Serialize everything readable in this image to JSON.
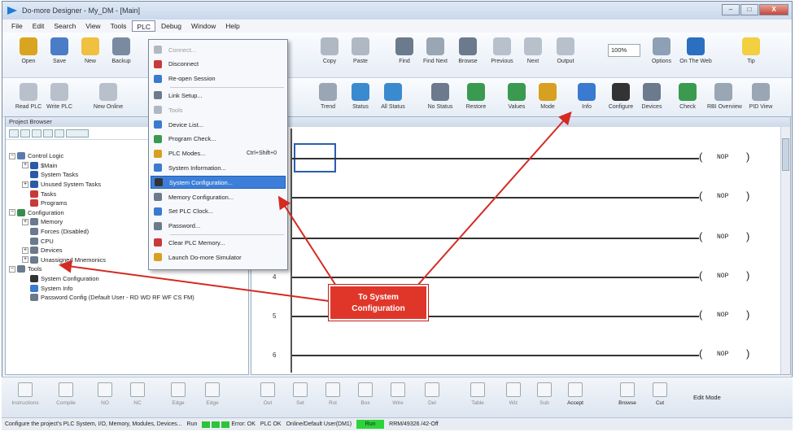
{
  "window": {
    "title": "Do-more Designer - My_DM - [Main]",
    "controls": [
      "–",
      "□",
      "X"
    ]
  },
  "menubar": [
    "File",
    "Edit",
    "Search",
    "View",
    "Tools",
    "PLC",
    "Debug",
    "Window",
    "Help"
  ],
  "toolbar1": [
    {
      "label": "Open",
      "icon": "open-icon",
      "color": "#d9a520"
    },
    {
      "label": "Save",
      "icon": "save-icon",
      "color": "#4a7cc8"
    },
    {
      "label": "New",
      "icon": "new-icon",
      "color": "#f0c040"
    },
    {
      "label": "Backup",
      "icon": "backup-icon",
      "color": "#7a8aa0"
    },
    {
      "label": "Copy",
      "icon": "copy-icon",
      "color": "#b0b8c4"
    },
    {
      "label": "Paste",
      "icon": "paste-icon",
      "color": "#b0b8c4"
    },
    {
      "label": "Find",
      "icon": "find-icon",
      "color": "#6b7a8c"
    },
    {
      "label": "Find Next",
      "icon": "find-next-icon",
      "color": "#9aa6b4"
    },
    {
      "label": "Browse",
      "icon": "browse-icon",
      "color": "#6b7a8c"
    },
    {
      "label": "Previous",
      "icon": "previous-icon",
      "color": "#b8c0cc"
    },
    {
      "label": "Next",
      "icon": "next-icon",
      "color": "#b8c0cc"
    },
    {
      "label": "Output",
      "icon": "output-icon",
      "color": "#b8c0cc"
    },
    {
      "label": "Options",
      "icon": "options-icon",
      "color": "#8ea0b6"
    },
    {
      "label": "On The Web",
      "icon": "web-icon",
      "color": "#2a6fc0"
    },
    {
      "label": "Tip",
      "icon": "tip-icon",
      "color": "#f2d040"
    }
  ],
  "zoom": "100%",
  "toolbar2": [
    {
      "label": "Read PLC",
      "icon": "read-plc-icon",
      "color": "#b8c0cc"
    },
    {
      "label": "Write PLC",
      "icon": "write-plc-icon",
      "color": "#b8c0cc"
    },
    {
      "label": "Trend",
      "icon": "trend-icon",
      "color": "#9aa6b4"
    },
    {
      "label": "Status",
      "icon": "status-icon",
      "color": "#3a8ad0"
    },
    {
      "label": "All Status",
      "icon": "all-status-icon",
      "color": "#3a8ad0"
    },
    {
      "label": "No Status",
      "icon": "no-status-icon",
      "color": "#6b7a8c"
    },
    {
      "label": "Restore",
      "icon": "restore-icon",
      "color": "#3a9a50"
    },
    {
      "label": "Values",
      "icon": "values-icon",
      "color": "#3a9a50"
    },
    {
      "label": "Mode",
      "icon": "mode-icon",
      "color": "#d8a020"
    },
    {
      "label": "Info",
      "icon": "info-icon",
      "color": "#3a7ad0"
    },
    {
      "label": "Configure",
      "icon": "configure-icon",
      "color": "#333333"
    },
    {
      "label": "Devices",
      "icon": "devices-icon",
      "color": "#6b7a8c"
    },
    {
      "label": "Check",
      "icon": "check-icon",
      "color": "#3a9a50"
    },
    {
      "label": "RBI Overview",
      "icon": "rbi-overview-icon",
      "color": "#9aa6b4"
    },
    {
      "label": "PID View",
      "icon": "pid-view-icon",
      "color": "#9aa6b4"
    }
  ],
  "toolbar2_left_extra": "New Online",
  "project_pane": {
    "title": "Project Browser",
    "tree": [
      {
        "level": 0,
        "exp": "−",
        "label": "Control Logic",
        "color": "#5a7ab0"
      },
      {
        "level": 1,
        "exp": "+",
        "label": "$Main",
        "color": "#2a5aa8"
      },
      {
        "level": 1,
        "exp": "",
        "label": "System Tasks",
        "color": "#2a5aa8"
      },
      {
        "level": 1,
        "exp": "+",
        "label": "Unused System Tasks",
        "color": "#2a5aa8"
      },
      {
        "level": 1,
        "exp": "",
        "label": "Tasks",
        "color": "#c83a3a"
      },
      {
        "level": 1,
        "exp": "",
        "label": "Programs",
        "color": "#c83a3a"
      },
      {
        "level": 0,
        "exp": "−",
        "label": "Configuration",
        "color": "#3a8a50"
      },
      {
        "level": 1,
        "exp": "+",
        "label": "Memory",
        "color": "#6b7a8c"
      },
      {
        "level": 1,
        "exp": "",
        "label": "Forces (Disabled)",
        "color": "#6b7a8c"
      },
      {
        "level": 1,
        "exp": "",
        "label": "CPU",
        "color": "#6b7a8c"
      },
      {
        "level": 1,
        "exp": "+",
        "label": "Devices",
        "color": "#6b7a8c"
      },
      {
        "level": 1,
        "exp": "+",
        "label": "Unassigned Mnemonics",
        "color": "#6b7a8c"
      },
      {
        "level": 0,
        "exp": "−",
        "label": "Tools",
        "color": "#6b7a8c"
      },
      {
        "level": 1,
        "exp": "",
        "label": "System Configuration",
        "color": "#333333"
      },
      {
        "level": 1,
        "exp": "",
        "label": "System Info",
        "color": "#3a7ad0"
      },
      {
        "level": 1,
        "exp": "",
        "label": "Password Config (Default User - RD WD RF WF CS FM)",
        "color": "#6b7a8c"
      }
    ]
  },
  "plc_menu": [
    {
      "label": "Connect...",
      "disabled": true,
      "color": "#b0b8c4"
    },
    {
      "label": "Disconnect",
      "disabled": false,
      "color": "#c83a3a"
    },
    {
      "label": "Re-open Session",
      "disabled": false,
      "color": "#3a7ad0"
    },
    {
      "sep": true
    },
    {
      "label": "Link Setup...",
      "disabled": false,
      "color": "#6b7a8c"
    },
    {
      "label": "Tools",
      "disabled": true,
      "color": "#b0b8c4"
    },
    {
      "label": "Device List...",
      "disabled": false,
      "color": "#3a7ad0"
    },
    {
      "label": "Program Check...",
      "disabled": false,
      "color": "#3a9a50"
    },
    {
      "label": "PLC Modes...",
      "shortcut": "Ctrl+Shift+0",
      "disabled": false,
      "color": "#d8a020"
    },
    {
      "label": "System Information...",
      "disabled": false,
      "color": "#3a7ad0"
    },
    {
      "label": "System Configuration...",
      "disabled": false,
      "highlight": true,
      "color": "#333333"
    },
    {
      "label": "Memory Configuration...",
      "disabled": false,
      "color": "#6b7a8c"
    },
    {
      "label": "Set PLC Clock...",
      "disabled": false,
      "color": "#3a7ad0"
    },
    {
      "label": "Password...",
      "disabled": false,
      "color": "#6b7a8c"
    },
    {
      "sep": true
    },
    {
      "label": "Clear PLC Memory...",
      "disabled": false,
      "color": "#c83a3a"
    },
    {
      "label": "Launch Do-more Simulator",
      "disabled": false,
      "color": "#d8a020"
    }
  ],
  "ladder": {
    "rungs": [
      {
        "num": "",
        "coil": "NOP"
      },
      {
        "num": "",
        "coil": "NOP"
      },
      {
        "num": "",
        "coil": "NOP"
      },
      {
        "num": "4",
        "coil": "NOP"
      },
      {
        "num": "5",
        "coil": "NOP"
      },
      {
        "num": "6",
        "coil": "NOP"
      }
    ]
  },
  "callout": {
    "line1": "To System",
    "line2": "Configuration",
    "color": "#e0362a"
  },
  "bottom_toolbar": [
    {
      "label": "Instructions"
    },
    {
      "label": "Compile"
    },
    {
      "label": "NO"
    },
    {
      "label": "NC"
    },
    {
      "label": "Edge"
    },
    {
      "label": "Edge"
    },
    {
      "label": "Out"
    },
    {
      "label": "Set"
    },
    {
      "label": "Rst"
    },
    {
      "label": "Box"
    },
    {
      "label": "Wire"
    },
    {
      "label": "Del"
    },
    {
      "label": "Table"
    },
    {
      "label": "Wiz"
    },
    {
      "label": "Sub"
    },
    {
      "label": "Accept"
    },
    {
      "label": "Browse"
    },
    {
      "label": "Cut"
    }
  ],
  "edit_mode": "Edit Mode",
  "statusbar": {
    "hint": "Configure the project's PLC System, I/O, Memory, Modules, Devices...",
    "run": "Run",
    "mode_text": "Run",
    "err": "Error: OK",
    "plc_ok": "PLC OK",
    "user": "Online/Default User(DM1)",
    "rung_info": "RRM/49326 /42-Off"
  }
}
